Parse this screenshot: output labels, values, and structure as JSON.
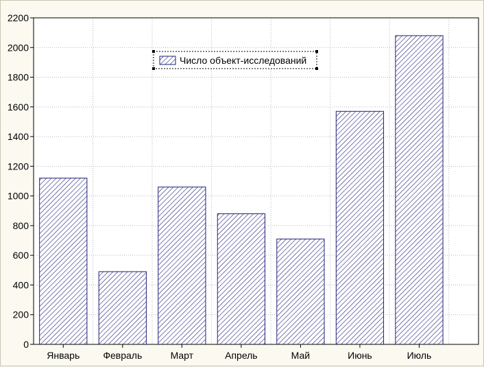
{
  "chart_data": {
    "type": "bar",
    "categories": [
      "Январь",
      "Февраль",
      "Март",
      "Апрель",
      "Май",
      "Июнь",
      "Июль"
    ],
    "series": [
      {
        "name": "Число объект-исследований",
        "values": [
          1120,
          490,
          1060,
          880,
          710,
          1570,
          2080
        ]
      }
    ],
    "title": "",
    "xlabel": "",
    "ylabel": "",
    "ylim": [
      0,
      2200
    ],
    "yticks": [
      0,
      200,
      400,
      600,
      800,
      1000,
      1200,
      1400,
      1600,
      1800,
      2000,
      2200
    ],
    "grid": true,
    "legend_position": "top-center",
    "bar_fill": "hatched",
    "colors": {
      "bar_stroke": "#1f1f7a",
      "hatch": "#1f1f7a",
      "grid": "#b8b8b8",
      "plot_bg": "#ffffff"
    }
  }
}
